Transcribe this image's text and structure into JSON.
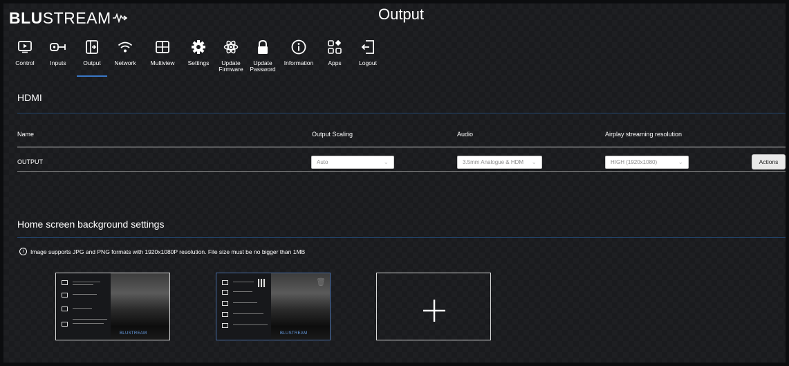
{
  "header": {
    "logo_bold": "BLU",
    "logo_light": "STREAM",
    "page_title": "Output"
  },
  "nav": [
    {
      "label": "Control",
      "icon": "play-screen-icon"
    },
    {
      "label": "Inputs",
      "icon": "input-plug-icon"
    },
    {
      "label": "Output",
      "icon": "output-arrow-icon",
      "active": true
    },
    {
      "label": "Network",
      "icon": "wifi-icon"
    },
    {
      "label": "Multiview",
      "icon": "multiview-grid-icon"
    },
    {
      "label": "Settings",
      "icon": "gear-icon"
    },
    {
      "label": "Update\nFirmware",
      "icon": "atom-icon"
    },
    {
      "label": "Update\nPassword",
      "icon": "lock-icon"
    },
    {
      "label": "Information",
      "icon": "info-icon"
    },
    {
      "label": "Apps",
      "icon": "apps-icon"
    },
    {
      "label": "Logout",
      "icon": "logout-icon"
    }
  ],
  "hdmi": {
    "section_title": "HDMI",
    "columns": [
      "Name",
      "Output Scaling",
      "Audio",
      "Airplay streaming resolution"
    ],
    "row": {
      "name": "OUTPUT",
      "output_scaling": "Auto",
      "audio": "3.5mm Analogue & HDM",
      "airplay_resolution": "HIGH (1920x1080)",
      "actions_label": "Actions"
    }
  },
  "background": {
    "section_title": "Home screen background settings",
    "info": "Image supports JPG and PNG formats with 1920x1080P resolution. File size must be no bigger than 1MB",
    "thumb_brand": "BLUSTREAM",
    "add_symbol": "+"
  },
  "colors": {
    "background": "#1a1b1e",
    "accent_blue": "#3a78c8",
    "section_rule": "#23466f"
  }
}
